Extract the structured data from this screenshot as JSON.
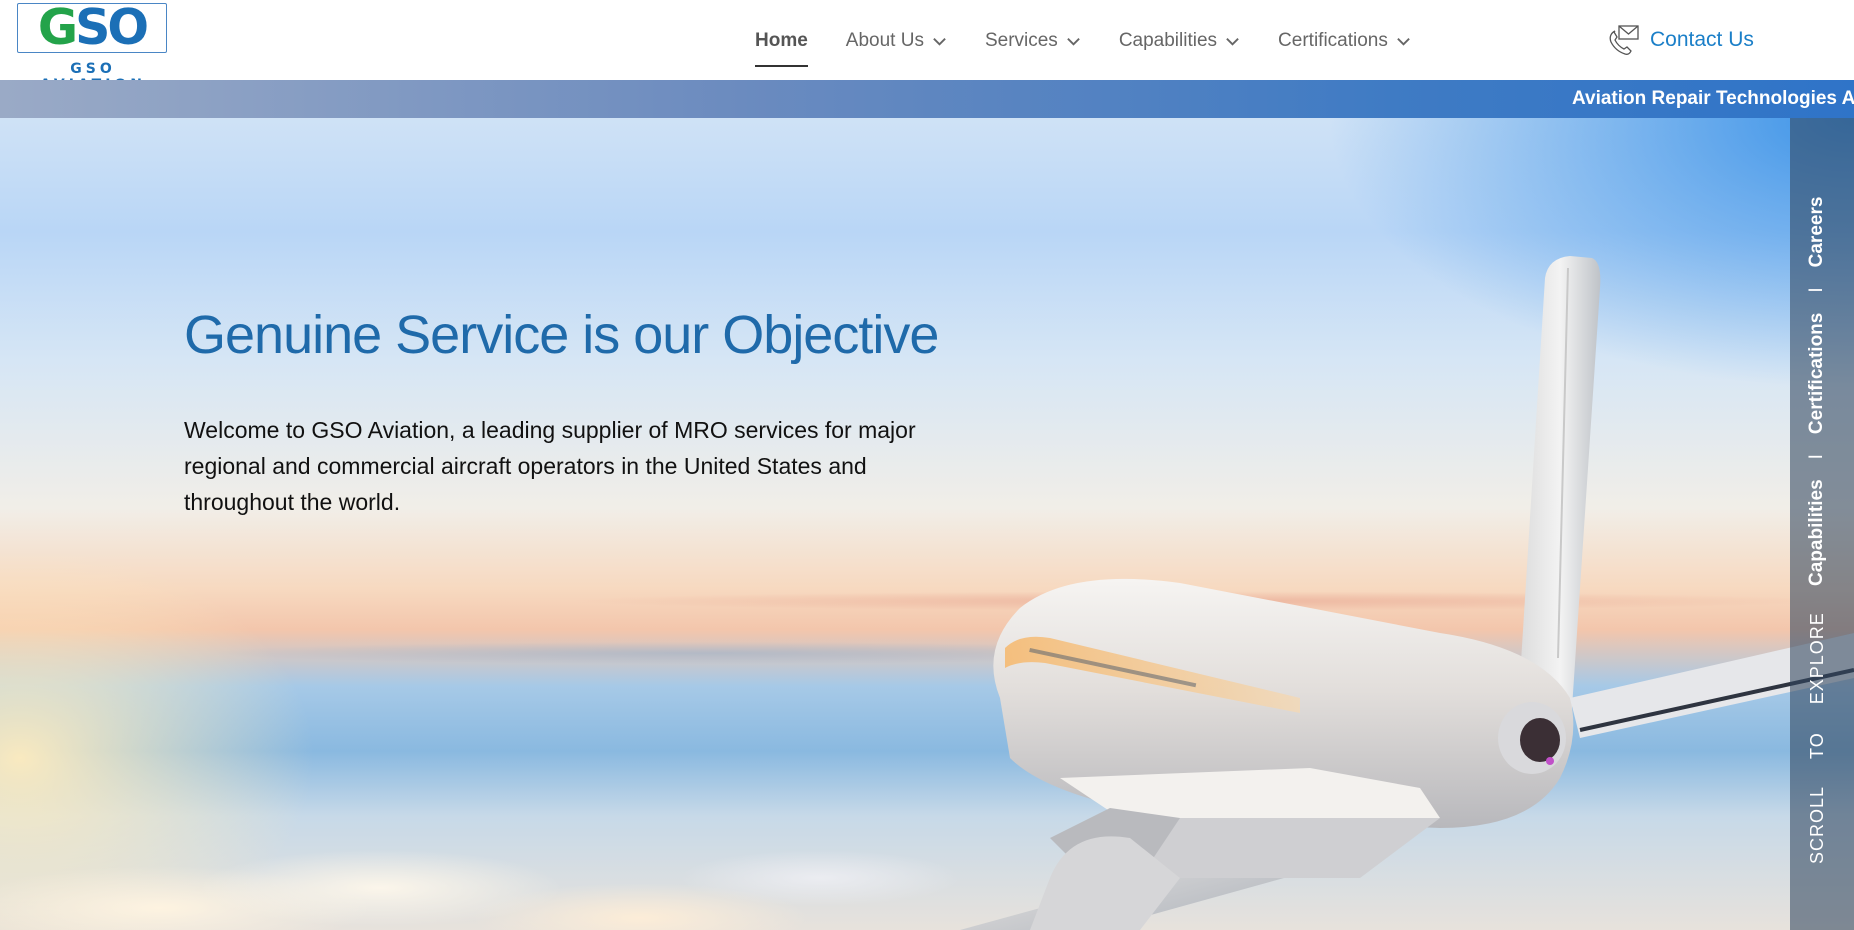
{
  "brand": {
    "logo_mark_g": "G",
    "logo_mark_so": "SO",
    "logo_sub": "GSO AVIATION",
    "colors": {
      "green": "#23a34a",
      "blue": "#1b6fb6",
      "link": "#1b7fc8",
      "title": "#1f6aaa"
    }
  },
  "nav": {
    "items": [
      {
        "label": "Home",
        "active": true,
        "has_dropdown": false
      },
      {
        "label": "About Us",
        "active": false,
        "has_dropdown": true
      },
      {
        "label": "Services",
        "active": false,
        "has_dropdown": true
      },
      {
        "label": "Capabilities",
        "active": false,
        "has_dropdown": true
      },
      {
        "label": "Certifications",
        "active": false,
        "has_dropdown": true
      }
    ],
    "contact": {
      "label": "Contact Us",
      "icon": "envelope-phone-icon"
    }
  },
  "ticker": {
    "text": "Aviation Repair Technologies An"
  },
  "hero": {
    "title": "Genuine Service is our Objective",
    "description": "Welcome to GSO Aviation, a leading supplier of MRO services for major regional and commercial aircraft operators in the United States and throughout the world."
  },
  "side_rail": {
    "links": [
      "Capabilities",
      "Certifications",
      "Careers"
    ],
    "separator": "I",
    "scroll_hint": "SCROLL TO EXPLORE"
  }
}
